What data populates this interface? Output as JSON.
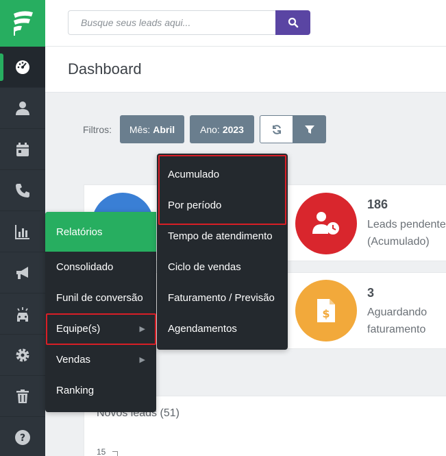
{
  "search": {
    "placeholder": "Busque seus leads aqui..."
  },
  "page": {
    "title": "Dashboard"
  },
  "filters": {
    "label": "Filtros:",
    "month_key": "Mês:",
    "month_value": "Abril",
    "year_key": "Ano:",
    "year_value": "2023"
  },
  "cards": [
    {
      "value": "186",
      "label_line1": "Leads pendente",
      "label_line2": "(Acumulado)"
    },
    {
      "value": "3",
      "label_line1": "Aguardando",
      "label_line2": "faturamento"
    }
  ],
  "chart": {
    "title": "Novos leads (51)",
    "tick": "15"
  },
  "reports_menu": {
    "header": "Relatórios",
    "items": [
      "Consolidado",
      "Funil de conversão",
      "Equipe(s)",
      "Vendas",
      "Ranking"
    ]
  },
  "team_submenu": {
    "items": [
      "Acumulado",
      "Por período",
      "Tempo de atendimento",
      "Ciclo de vendas",
      "Faturamento / Previsão",
      "Agendamentos"
    ]
  },
  "colors": {
    "brand_green": "#27ae60",
    "search_purple": "#5a45a3",
    "highlight_red": "#d91e26",
    "card_red": "#d9262d",
    "card_orange": "#f2a93b",
    "card_blue": "#3a7fd5"
  }
}
